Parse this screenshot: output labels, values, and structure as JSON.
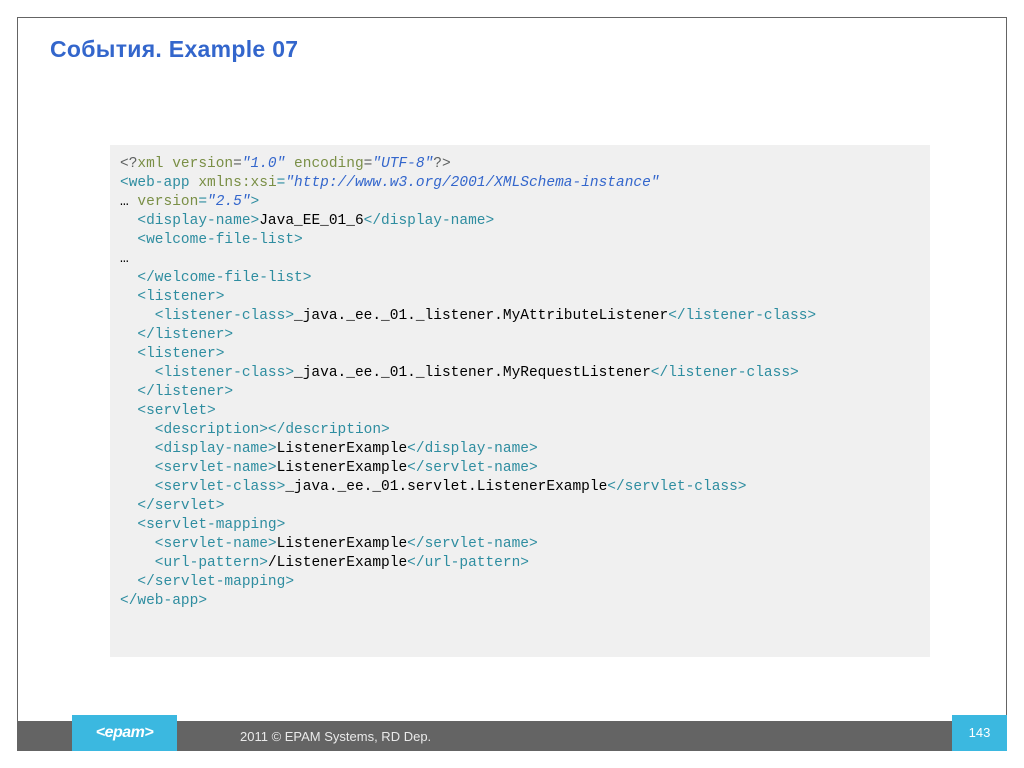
{
  "title": "События. Example 07",
  "footer": {
    "logo": "<epam>",
    "copyright": "2011 © EPAM Systems, RD Dep.",
    "page": "143"
  },
  "code": {
    "l1": {
      "a": "<?",
      "b": "xml version",
      "c": "=",
      "d": "\"1.0\"",
      "e": " encoding",
      "f": "=",
      "g": "\"UTF-8\"",
      "h": "?>"
    },
    "l2": {
      "a": "<web-app",
      "b": " xmlns:xsi",
      "c": "=",
      "d": "\"http://www.w3.org/2001/XMLSchema-instance\""
    },
    "l3": {
      "a": "…",
      "b": " version",
      "c": "=",
      "d": "\"2.5\"",
      "e": ">"
    },
    "l4": {
      "a": "  <display-name>",
      "b": "Java_EE_01_6",
      "c": "</display-name>"
    },
    "l5": {
      "a": "  <welcome-file-list>"
    },
    "l6": {
      "a": "…"
    },
    "l7": {
      "a": "  </welcome-file-list>"
    },
    "l8": {
      "a": "  <listener>"
    },
    "l9": {
      "a": "    <listener-class>",
      "b": "_java._ee._01._listener.MyAttributeListener",
      "c": "</listener-class>"
    },
    "l10": {
      "a": "  </listener>"
    },
    "l11": {
      "a": "  <listener>"
    },
    "l12": {
      "a": "    <listener-class>",
      "b": "_java._ee._01._listener.MyRequestListener",
      "c": "</listener-class>"
    },
    "l13": {
      "a": "  </listener>"
    },
    "l14": {
      "a": "  <servlet>"
    },
    "l15": {
      "a": "    <description></description>"
    },
    "l16": {
      "a": "    <display-name>",
      "b": "ListenerExample",
      "c": "</display-name>"
    },
    "l17": {
      "a": "    <servlet-name>",
      "b": "ListenerExample",
      "c": "</servlet-name>"
    },
    "l18": {
      "a": "    <servlet-class>",
      "b": "_java._ee._01.servlet.ListenerExample",
      "c": "</servlet-class>"
    },
    "l19": {
      "a": "  </servlet>"
    },
    "l20": {
      "a": "  <servlet-mapping>"
    },
    "l21": {
      "a": "    <servlet-name>",
      "b": "ListenerExample",
      "c": "</servlet-name>"
    },
    "l22": {
      "a": "    <url-pattern>",
      "b": "/ListenerExample",
      "c": "</url-pattern>"
    },
    "l23": {
      "a": "  </servlet-mapping>"
    },
    "l24": {
      "a": "</web-app>"
    }
  }
}
